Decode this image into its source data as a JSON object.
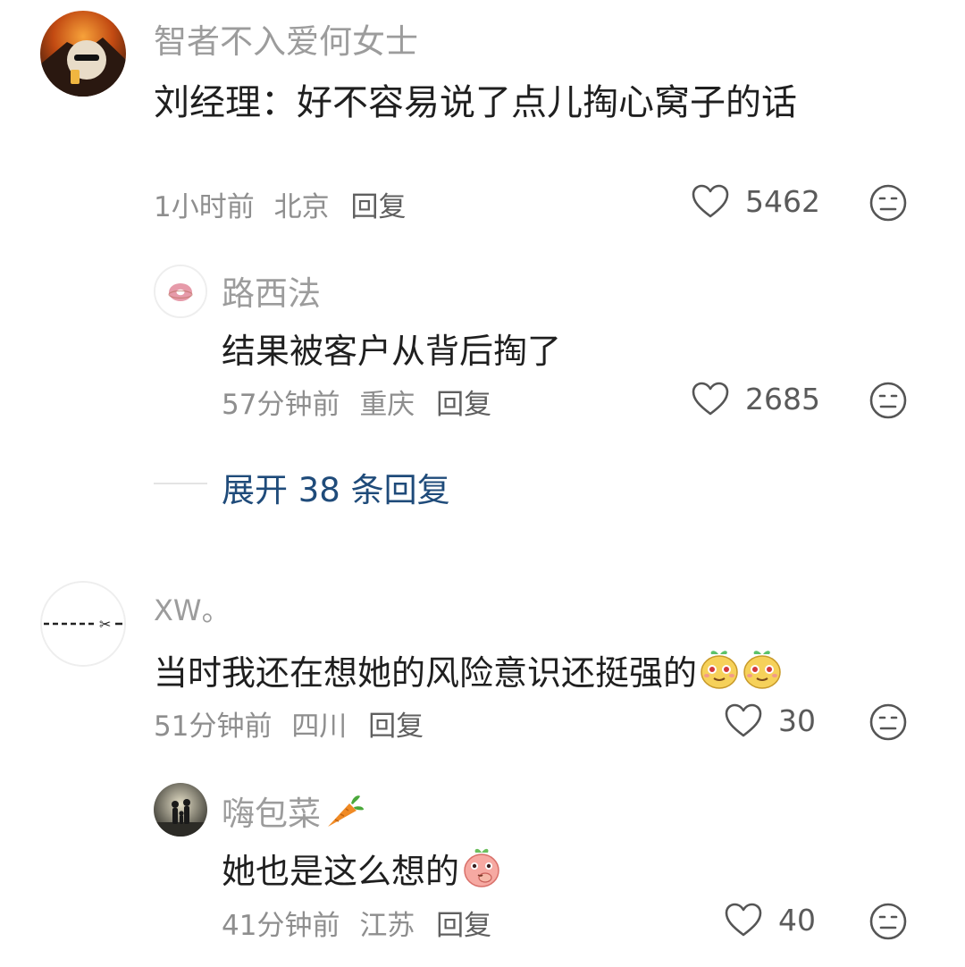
{
  "comments": [
    {
      "author": "智者不入爱何女士",
      "text": "刘经理：好不容易说了点儿掏心窝子的话",
      "time": "1小时前",
      "location": "北京",
      "reply_label": "回复",
      "likes": "5462",
      "avatar": "volcano-avatar",
      "replies": [
        {
          "author": "路西法",
          "text": "结果被客户从背后掏了",
          "time": "57分钟前",
          "location": "重庆",
          "reply_label": "回复",
          "likes": "2685",
          "avatar": "donut-avatar"
        }
      ],
      "expand_label": "展开 38 条回复"
    },
    {
      "author": "XW。",
      "text": "当时我还在想她的风险意识还挺强的",
      "text_emojis": [
        "smirk-sprout-emoji",
        "smirk-sprout-emoji"
      ],
      "time": "51分钟前",
      "location": "四川",
      "reply_label": "回复",
      "likes": "30",
      "avatar": "scissors-avatar",
      "replies": [
        {
          "author": "嗨包菜",
          "author_emoji": "carrot-emoji",
          "text": "她也是这么想的",
          "text_emojis": [
            "thinking-peach-emoji"
          ],
          "time": "41分钟前",
          "location": "江苏",
          "reply_label": "回复",
          "likes": "40",
          "avatar": "silhouette-avatar"
        }
      ]
    }
  ],
  "icons": {
    "like": "heart-outline-icon",
    "dislike": "meh-face-icon"
  },
  "colors": {
    "link": "#1f4b7a",
    "name": "#9c9c9c",
    "text": "#1f1f1f"
  }
}
